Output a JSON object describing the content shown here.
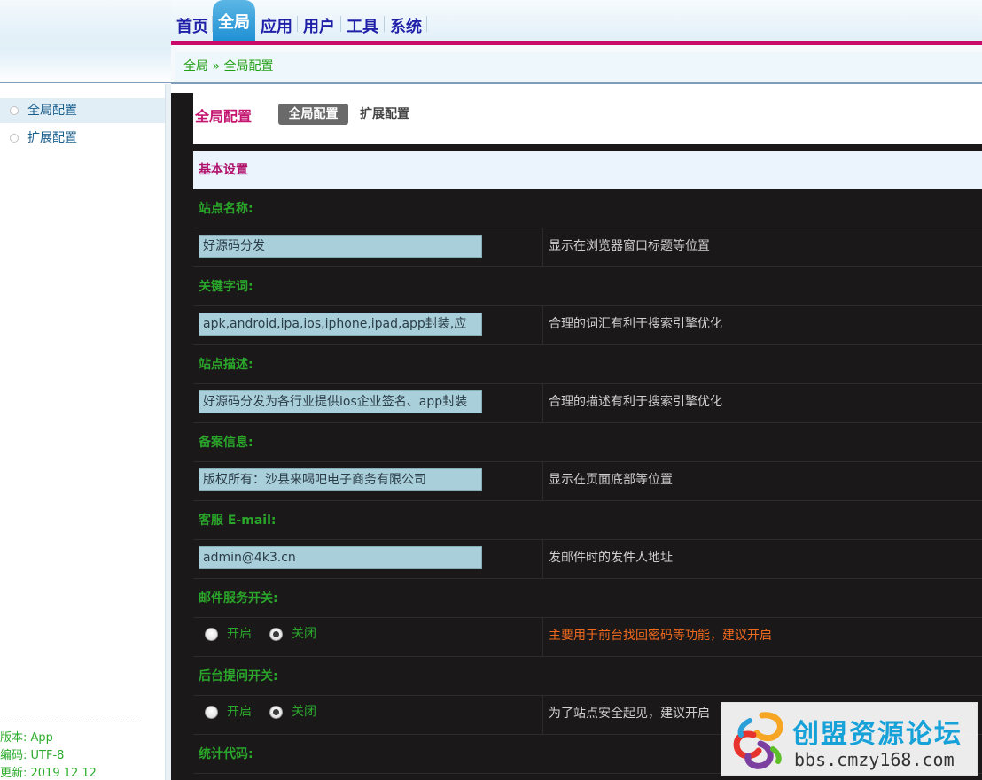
{
  "nav": {
    "items": [
      "首页",
      "全局",
      "应用",
      "用户",
      "工具",
      "系统"
    ],
    "active": "全局"
  },
  "breadcrumb": {
    "root": "全局",
    "separator": "»",
    "current": "全局配置"
  },
  "sidebar": {
    "items": [
      {
        "label": "全局配置",
        "active": true
      },
      {
        "label": "扩展配置",
        "active": false
      }
    ],
    "meta": {
      "version": "版本: App",
      "encoding": "编码: UTF-8",
      "updated": "更新: 2019 12 12"
    }
  },
  "main": {
    "title": "全局配置",
    "tabs": [
      "全局配置",
      "扩展配置"
    ],
    "section": "基本设置",
    "fields": [
      {
        "label": "站点名称:",
        "value": "好源码分发",
        "hint": "显示在浏览器窗口标题等位置"
      },
      {
        "label": "关键字词:",
        "value": "apk,android,ipa,ios,iphone,ipad,app封装,应",
        "hint": "合理的词汇有利于搜索引擎优化"
      },
      {
        "label": "站点描述:",
        "value": "好源码分发为各行业提供ios企业签名、app封装",
        "hint": "合理的描述有利于搜索引擎优化"
      },
      {
        "label": "备案信息:",
        "value": "版权所有：沙县来喝吧电子商务有限公司",
        "hint": "显示在页面底部等位置"
      },
      {
        "label": "客服 E-mail:",
        "value": "admin@4k3.cn",
        "hint": "发邮件时的发件人地址"
      }
    ],
    "switches": [
      {
        "label": "邮件服务开关:",
        "on_label": "开启",
        "off_label": "关闭",
        "selected": "关闭",
        "hint": "主要用于前台找回密码等功能，建议开启"
      },
      {
        "label": "后台提问开关:",
        "on_label": "开启",
        "off_label": "关闭",
        "selected": "关闭",
        "hint": "为了站点安全起见，建议开启"
      }
    ],
    "last_label": "统计代码:"
  },
  "watermark": {
    "cn": "创盟资源论坛",
    "en": "bbs.cmzy168.com"
  },
  "colors": {
    "nav_text": "#1f1fa8",
    "accent_pink": "#c90a6c",
    "label_green": "#2aa62a",
    "input_bg": "#a9cfdb",
    "main_bg": "#1b1819",
    "warn_hint": "#f06a1e"
  }
}
